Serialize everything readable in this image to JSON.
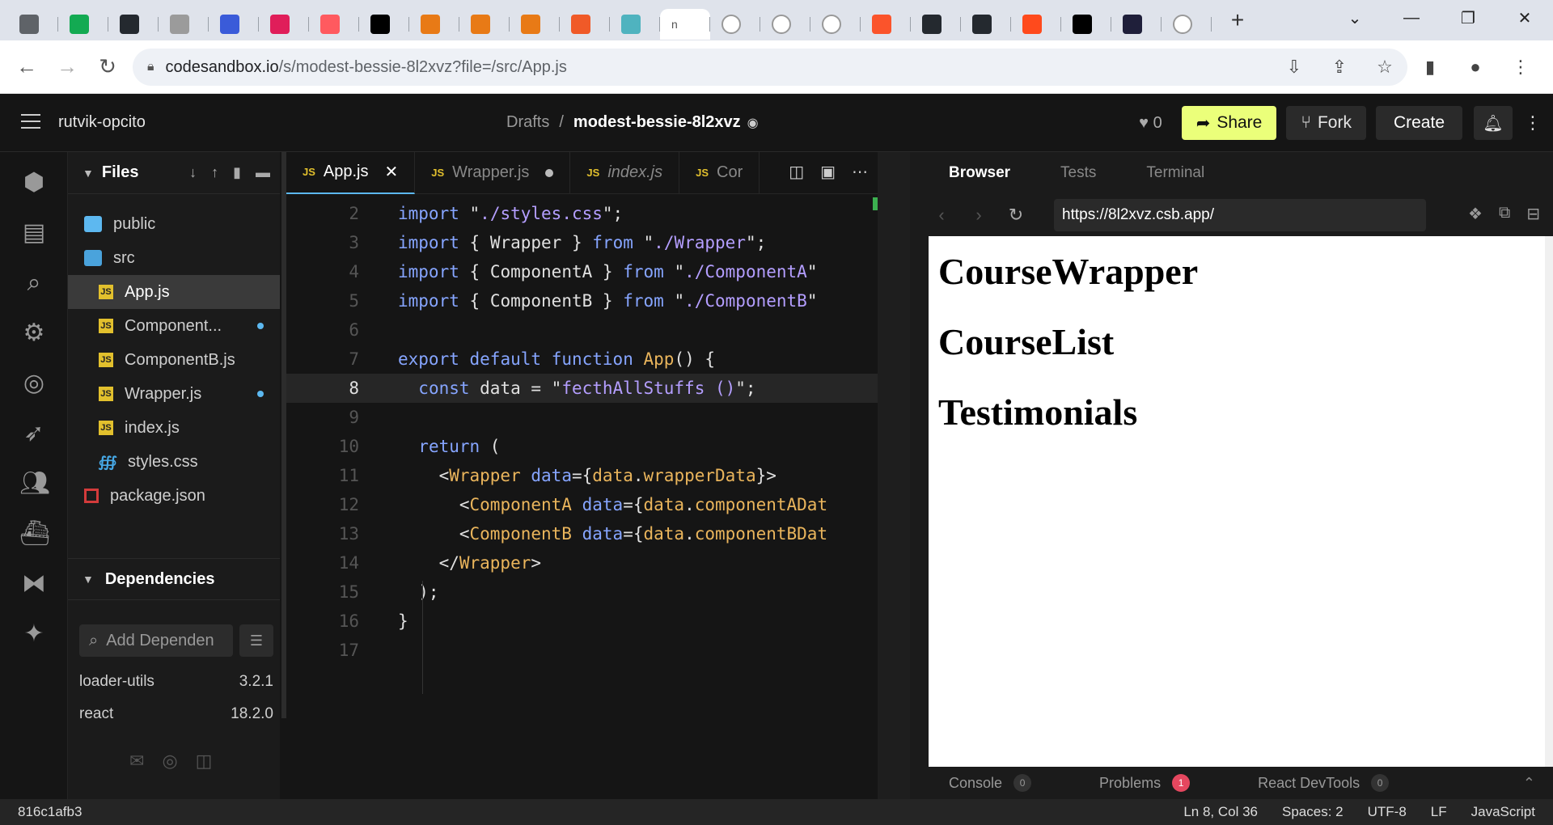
{
  "browser": {
    "tabs": [
      {
        "label": "",
        "icon": "chrome-icon",
        "bg": "#5f6368"
      },
      {
        "label": "",
        "icon": "mongodb-icon",
        "bg": "#13aa52"
      },
      {
        "label": "",
        "icon": "github-icon",
        "bg": "#24292f"
      },
      {
        "label": "",
        "icon": "leaf-icon",
        "bg": "#9b9b9b"
      },
      {
        "label": "",
        "icon": "star-icon",
        "bg": "#3a5bd9"
      },
      {
        "label": "",
        "icon": "slack-icon",
        "bg": "#e01e5a"
      },
      {
        "label": "",
        "icon": "circle-icon",
        "bg": "#ff5a5f"
      },
      {
        "label": "",
        "icon": "medium-icon",
        "bg": "#000000"
      },
      {
        "label": "",
        "icon": "triangle-icon",
        "bg": "#e87a16"
      },
      {
        "label": "",
        "icon": "triangle-icon",
        "bg": "#e87a16"
      },
      {
        "label": "",
        "icon": "triangle-icon",
        "bg": "#e87a16"
      },
      {
        "label": "",
        "icon": "hexagon-icon",
        "bg": "#f05a28"
      },
      {
        "label": "",
        "icon": "leaf-icon",
        "bg": "#4fb3bf"
      },
      {
        "label": "n",
        "icon": "",
        "bg": "#ffffff"
      },
      {
        "label": "",
        "icon": "google-icon",
        "bg": "#ffffff"
      },
      {
        "label": "",
        "icon": "square-icon",
        "bg": "#ffffff"
      },
      {
        "label": "",
        "icon": "google-icon",
        "bg": "#ffffff"
      },
      {
        "label": "",
        "icon": "brave-icon",
        "bg": "#fb542b"
      },
      {
        "label": "",
        "icon": "github-icon",
        "bg": "#24292f"
      },
      {
        "label": "",
        "icon": "github-icon",
        "bg": "#24292f"
      },
      {
        "label": "",
        "icon": "play-icon",
        "bg": "#ff4a1c"
      },
      {
        "label": "",
        "icon": "medium-icon",
        "bg": "#000000"
      },
      {
        "label": "",
        "icon": "lambda-icon",
        "bg": "#1f1f3a"
      },
      {
        "label": "",
        "icon": "google-icon",
        "bg": "#ffffff"
      }
    ],
    "url_host": "codesandbox.io",
    "url_path": "/s/modest-bessie-8l2xvz?file=/src/App.js"
  },
  "header": {
    "user": "rutvik-opcito",
    "crumb_root": "Drafts",
    "crumb_sep": "/",
    "project": "modest-bessie-8l2xvz",
    "likes": "0",
    "share": "Share",
    "fork": "Fork",
    "create": "Create"
  },
  "sidebar": {
    "files_title": "Files",
    "tree": [
      {
        "name": "public",
        "type": "folder",
        "indent": 0
      },
      {
        "name": "src",
        "type": "folder-open",
        "indent": 0
      },
      {
        "name": "App.js",
        "type": "js",
        "indent": 1,
        "active": true
      },
      {
        "name": "Component...",
        "type": "js",
        "indent": 1,
        "dot": true
      },
      {
        "name": "ComponentB.js",
        "type": "js",
        "indent": 1
      },
      {
        "name": "Wrapper.js",
        "type": "js",
        "indent": 1,
        "dot": true
      },
      {
        "name": "index.js",
        "type": "js",
        "indent": 1
      },
      {
        "name": "styles.css",
        "type": "css",
        "indent": 1
      },
      {
        "name": "package.json",
        "type": "pkg",
        "indent": 0
      }
    ],
    "deps_title": "Dependencies",
    "deps_placeholder": "Add Dependen",
    "deps": [
      {
        "name": "loader-utils",
        "version": "3.2.1"
      },
      {
        "name": "react",
        "version": "18.2.0"
      }
    ]
  },
  "editor": {
    "tabs": [
      {
        "label": "App.js",
        "active": true,
        "close": "✕"
      },
      {
        "label": "Wrapper.js",
        "dirty": true
      },
      {
        "label": "index.js",
        "italic": true
      },
      {
        "label": "Cor"
      }
    ],
    "lines": [
      {
        "n": "2",
        "html": "<span class='kw'>import</span> <span class='q'>\"</span><span class='str'>./styles.css</span><span class='q'>\";</span>"
      },
      {
        "n": "3",
        "html": "<span class='kw'>import</span> <span class='brace'>{</span> Wrapper <span class='brace'>}</span> <span class='kw'>from</span> <span class='q'>\"</span><span class='str'>./Wrapper</span><span class='q'>\";</span>"
      },
      {
        "n": "4",
        "html": "<span class='kw'>import</span> <span class='brace'>{</span> ComponentA <span class='brace'>}</span> <span class='kw'>from</span> <span class='q'>\"</span><span class='str'>./ComponentA</span><span class='q'>\"</span>"
      },
      {
        "n": "5",
        "html": "<span class='kw'>import</span> <span class='brace'>{</span> ComponentB <span class='brace'>}</span> <span class='kw'>from</span> <span class='q'>\"</span><span class='str'>./ComponentB</span><span class='q'>\"</span>"
      },
      {
        "n": "6",
        "html": ""
      },
      {
        "n": "7",
        "html": "<span class='kw'>export</span> <span class='kw'>default</span> <span class='kw'>function</span> <span class='fn'>App</span>() <span class='brace'>{</span>"
      },
      {
        "n": "8",
        "html": "  <span class='kw'>const</span> data = <span class='q'>\"</span><span class='str'>fecthAllStuffs ()</span><span class='q'>\";</span>",
        "hl": true
      },
      {
        "n": "9",
        "html": ""
      },
      {
        "n": "10",
        "html": "  <span class='kw'>return</span> ("
      },
      {
        "n": "11",
        "html": "    &lt;<span class='tag'>Wrapper</span> <span class='attr'>data</span>=<span class='brace'>{</span><span class='prop'>data</span>.<span class='prop'>wrapperData</span><span class='brace'>}</span>&gt;"
      },
      {
        "n": "12",
        "html": "      &lt;<span class='tag'>ComponentA</span> <span class='attr'>data</span>=<span class='brace'>{</span><span class='prop'>data</span>.<span class='prop'>componentADat</span>"
      },
      {
        "n": "13",
        "html": "      &lt;<span class='tag'>ComponentB</span> <span class='attr'>data</span>=<span class='brace'>{</span><span class='prop'>data</span>.<span class='prop'>componentBDat</span>"
      },
      {
        "n": "14",
        "html": "    &lt;/<span class='tag'>Wrapper</span>&gt;"
      },
      {
        "n": "15",
        "html": "  );"
      },
      {
        "n": "16",
        "html": "<span class='brace'>}</span>"
      },
      {
        "n": "17",
        "html": ""
      }
    ]
  },
  "preview": {
    "tabs": [
      "Browser",
      "Tests",
      "Terminal"
    ],
    "url": "https://8l2xvz.csb.app/",
    "headings": [
      "CourseWrapper",
      "CourseList",
      "Testimonials"
    ],
    "console": "Console",
    "console_count": "0",
    "problems": "Problems",
    "problems_count": "1",
    "devtools": "React DevTools",
    "devtools_count": "0"
  },
  "status": {
    "commit": "816c1afb3",
    "position": "Ln 8, Col 36",
    "spaces": "Spaces: 2",
    "encoding": "UTF-8",
    "eol": "LF",
    "language": "JavaScript"
  }
}
